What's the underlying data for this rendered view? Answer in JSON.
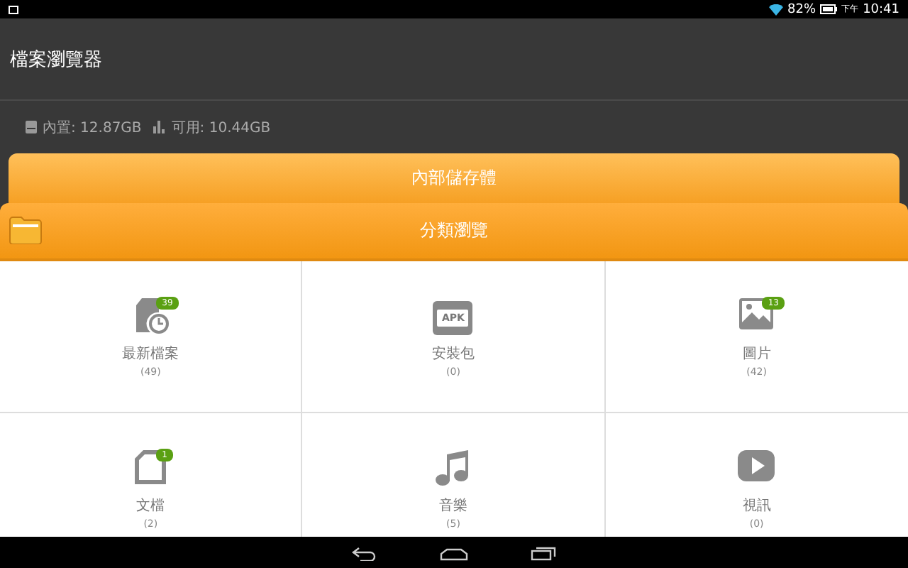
{
  "status_bar": {
    "battery": "82%",
    "period": "下午",
    "time": "10:41"
  },
  "app_bar": {
    "title": "檔案瀏覽器"
  },
  "storage": {
    "internal": "內置: 12.87GB",
    "available": "可用: 10.44GB"
  },
  "sections": [
    {
      "label": "內部儲存體"
    },
    {
      "label": "分類瀏覽"
    }
  ],
  "categories": [
    {
      "kind": "recent",
      "label": "最新檔案",
      "count": "(49)",
      "badge": "39"
    },
    {
      "kind": "apk",
      "label": "安裝包",
      "count": "(0)",
      "icon_text": "APK"
    },
    {
      "kind": "image",
      "label": "圖片",
      "count": "(42)",
      "badge": "13"
    },
    {
      "kind": "document",
      "label": "文檔",
      "count": "(2)",
      "badge": "1"
    },
    {
      "kind": "music",
      "label": "音樂",
      "count": "(5)"
    },
    {
      "kind": "video",
      "label": "視訊",
      "count": "(0)"
    }
  ]
}
